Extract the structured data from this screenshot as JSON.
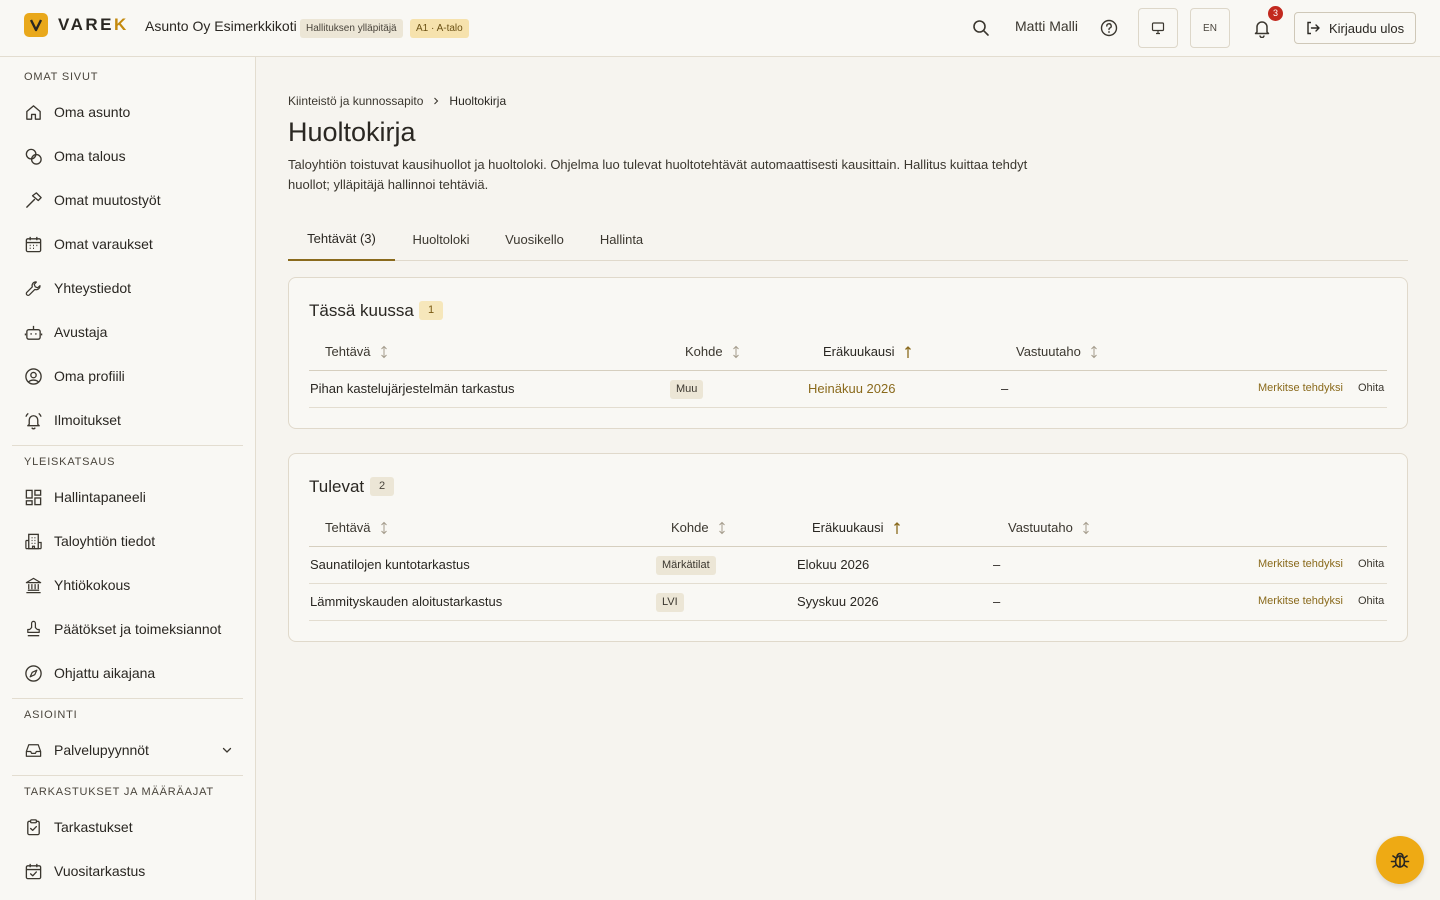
{
  "header": {
    "logo_text_main": "VARE",
    "logo_text_accent": "K",
    "org_name": "Asunto Oy Esimerkkikoti",
    "role_badge": "Hallituksen ylläpitäjä",
    "unit_badge": "A1 · A-talo",
    "user_name": "Matti Malli",
    "lang": "EN",
    "notification_count": "3",
    "logout_label": "Kirjaudu ulos"
  },
  "sidebar": {
    "sections": [
      {
        "title": "OMAT SIVUT",
        "items": [
          {
            "label": "Oma asunto",
            "icon": "home-icon"
          },
          {
            "label": "Oma talous",
            "icon": "coins-icon"
          },
          {
            "label": "Omat muutostyöt",
            "icon": "hammer-icon"
          },
          {
            "label": "Omat varaukset",
            "icon": "calendar-icon"
          },
          {
            "label": "Yhteystiedot",
            "icon": "wrench-icon"
          },
          {
            "label": "Avustaja",
            "icon": "bot-icon"
          },
          {
            "label": "Oma profiili",
            "icon": "user-circle-icon"
          },
          {
            "label": "Ilmoitukset",
            "icon": "bell-ring-icon"
          }
        ]
      },
      {
        "title": "YLEISKATSAUS",
        "items": [
          {
            "label": "Hallintapaneeli",
            "icon": "dashboard-icon"
          },
          {
            "label": "Taloyhtiön tiedot",
            "icon": "building-icon"
          },
          {
            "label": "Yhtiökokous",
            "icon": "landmark-icon"
          },
          {
            "label": "Päätökset ja toimeksiannot",
            "icon": "stamp-icon"
          },
          {
            "label": "Ohjattu aikajana",
            "icon": "compass-icon"
          }
        ]
      },
      {
        "title": "ASIOINTI",
        "items": [
          {
            "label": "Palvelupyynnöt",
            "icon": "inbox-icon"
          }
        ]
      },
      {
        "title": "TARKASTUKSET JA MÄÄRÄAJAT",
        "items": [
          {
            "label": "Tarkastukset",
            "icon": "clipboard-check-icon"
          },
          {
            "label": "Vuositarkastus",
            "icon": "calendar-check-icon"
          }
        ]
      }
    ]
  },
  "breadcrumb": {
    "parent": "Kiinteistö ja kunnossapito",
    "current": "Huoltokirja"
  },
  "page": {
    "title": "Huoltokirja",
    "description": "Taloyhtiön toistuvat kausihuollot ja huoltoloki. Ohjelma luo tulevat huoltotehtävät automaattisesti kausittain. Hallitus kuittaa tehdyt huollot; ylläpitäjä hallinnoi tehtäviä."
  },
  "tabs": [
    {
      "label": "Tehtävät",
      "count": "(3)"
    },
    {
      "label": "Huoltoloki",
      "count": ""
    },
    {
      "label": "Vuosikello",
      "count": ""
    },
    {
      "label": "Hallinta",
      "count": ""
    }
  ],
  "columns": {
    "task": "Tehtävä",
    "target": "Kohde",
    "due": "Eräkuukausi",
    "responsible": "Vastuutaho"
  },
  "actions": {
    "done": "Merkitse tehdyksi",
    "skip": "Ohita"
  },
  "this_month": {
    "title": "Tässä kuussa",
    "count": "1",
    "rows": [
      {
        "task": "Pihan kastelujärjestelmän tarkastus",
        "target": "Muu",
        "due": "Heinäkuu 2026",
        "responsible": "–"
      }
    ]
  },
  "upcoming": {
    "title": "Tulevat",
    "count": "2",
    "rows": [
      {
        "task": "Saunatilojen kuntotarkastus",
        "target": "Märkätilat",
        "due": "Elokuu 2026",
        "responsible": "–"
      },
      {
        "task": "Lämmityskauden aloitustarkastus",
        "target": "LVI",
        "due": "Syyskuu 2026",
        "responsible": "–"
      }
    ]
  },
  "colors": {
    "accent": "#e9a81b",
    "accent_text": "#8a6a1c",
    "background": "#f6f4ef",
    "notification": "#c2291e"
  }
}
